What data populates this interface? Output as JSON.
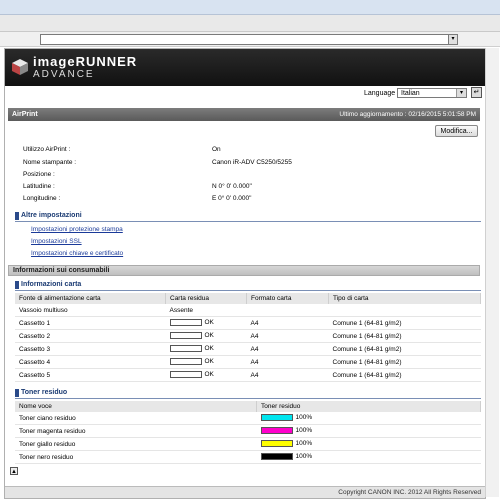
{
  "language": {
    "label": "Language",
    "selected": "Italian"
  },
  "brand": {
    "line1": "imageRUNNER",
    "line2": "ADVANCE"
  },
  "header": {
    "title": "AirPrint",
    "updated": "Ultimo aggiornamento : 02/16/2015 5:01:58 PM"
  },
  "edit_label": "Modifica...",
  "fields": [
    {
      "label": "Utilizzo AirPrint :",
      "value": "On"
    },
    {
      "label": "Nome stampante :",
      "value": "Canon iR-ADV C5250/5255"
    },
    {
      "label": "Posizione :",
      "value": ""
    },
    {
      "label": "Latitudine :",
      "value": "N 0° 0' 0.000\""
    },
    {
      "label": "Longitudine :",
      "value": "E 0° 0' 0.000\""
    }
  ],
  "other_settings": {
    "title": "Altre impostazioni",
    "links": [
      "Impostazioni protezione stampa",
      "Impostazioni SSL",
      "Impostazioni chiave e certificato"
    ]
  },
  "consumables_title": "Informazioni sui consumabili",
  "paper": {
    "title": "Informazioni carta",
    "headers": [
      "Fonte di alimentazione carta",
      "Carta residua",
      "Formato carta",
      "Tipo di carta"
    ],
    "rows": [
      {
        "source": "Vassoio multiuso",
        "remaining": "Assente",
        "bar": false,
        "size": "",
        "type": ""
      },
      {
        "source": "Cassetto 1",
        "remaining": "OK",
        "bar": true,
        "size": "A4",
        "type": "Comune 1 (64-81 g/m2)"
      },
      {
        "source": "Cassetto 2",
        "remaining": "OK",
        "bar": true,
        "size": "A4",
        "type": "Comune 1 (64-81 g/m2)"
      },
      {
        "source": "Cassetto 3",
        "remaining": "OK",
        "bar": true,
        "size": "A4",
        "type": "Comune 1 (64-81 g/m2)"
      },
      {
        "source": "Cassetto 4",
        "remaining": "OK",
        "bar": true,
        "size": "A4",
        "type": "Comune 1 (64-81 g/m2)"
      },
      {
        "source": "Cassetto 5",
        "remaining": "OK",
        "bar": true,
        "size": "A4",
        "type": "Comune 1 (64-81 g/m2)"
      }
    ]
  },
  "toner": {
    "title": "Toner residuo",
    "headers": [
      "Nome voce",
      "Toner residuo"
    ],
    "rows": [
      {
        "name": "Toner ciano residuo",
        "color": "#00e5ee",
        "value": "100%"
      },
      {
        "name": "Toner magenta residuo",
        "color": "#ff00cc",
        "value": "100%"
      },
      {
        "name": "Toner giallo residuo",
        "color": "#ffff00",
        "value": "100%"
      },
      {
        "name": "Toner nero residuo",
        "color": "#000000",
        "value": "100%"
      }
    ]
  },
  "copyright": "Copyright CANON INC. 2012 All Rights Reserved"
}
